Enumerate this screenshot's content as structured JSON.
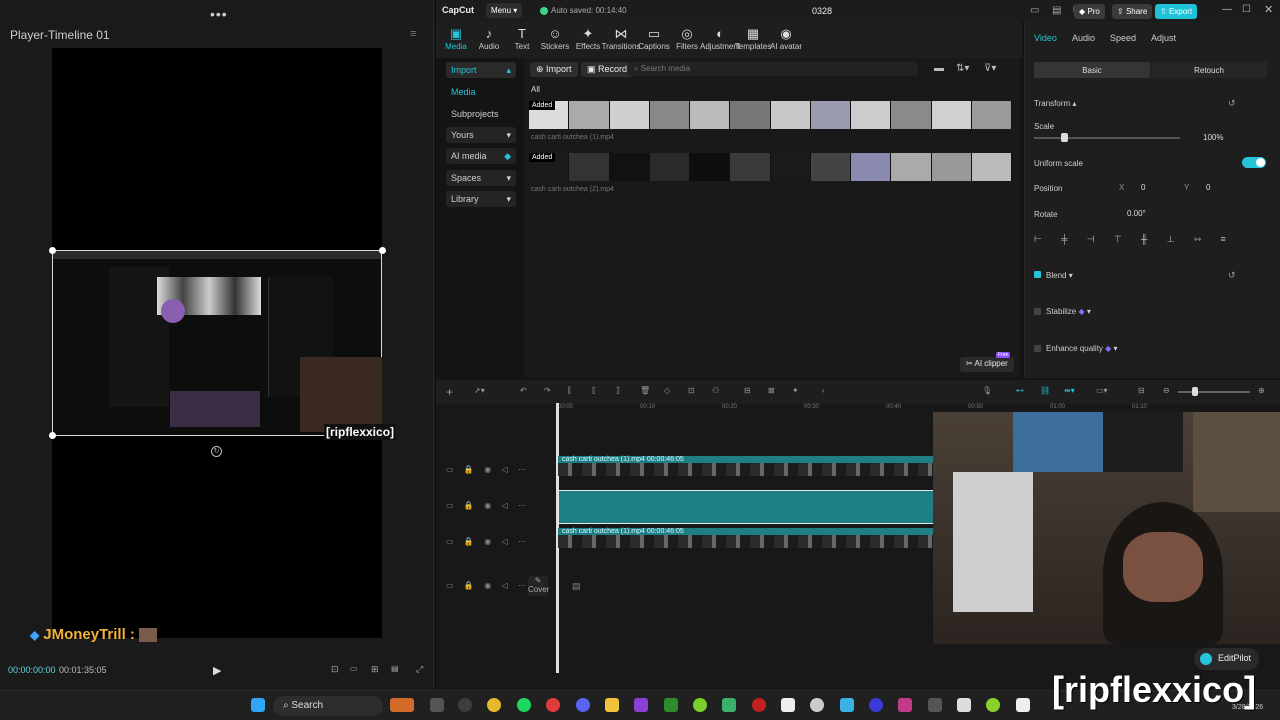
{
  "player": {
    "title": "Player-Timeline 01",
    "current_time": "00:00:00:00",
    "total_time": "00:01:35:05",
    "watermark": "[ripflexxico]",
    "chat_user": "JMoneyTrill :"
  },
  "topbar": {
    "app_name": "CapCut",
    "menu_label": "Menu",
    "autosave": "Auto saved: 00:14:40",
    "project_name": "0328",
    "pro_label": "Pro",
    "share_label": "Share",
    "export_label": "Export"
  },
  "toolbar": {
    "tools": [
      "Media",
      "Audio",
      "Text",
      "Stickers",
      "Effects",
      "Transitions",
      "Captions",
      "Filters",
      "Adjustment",
      "Templates",
      "AI avatar"
    ]
  },
  "media_nav": {
    "items": [
      "Import",
      "Media",
      "Subprojects",
      "Yours",
      "AI media",
      "Spaces",
      "Library"
    ]
  },
  "media": {
    "import_label": "Import",
    "record_label": "Record",
    "search_placeholder": "Search media",
    "filter_label": "All",
    "clips": [
      {
        "badge": "Added",
        "name": "cash carti outchea (1).mp4"
      },
      {
        "badge": "Added",
        "name": "cash carti outchea (2).mp4"
      }
    ],
    "ai_clipper": "AI clipper",
    "ai_badge": "Free"
  },
  "inspector": {
    "tabs": [
      "Video",
      "Audio",
      "Speed",
      "Adjust"
    ],
    "subtabs": [
      "Basic",
      "Retouch"
    ],
    "transform": "Transform",
    "scale_label": "Scale",
    "scale_value": "100%",
    "uniform_scale": "Uniform scale",
    "position_label": "Position",
    "pos_x_label": "X",
    "pos_x": "0",
    "pos_y_label": "Y",
    "pos_y": "0",
    "rotate_label": "Rotate",
    "rotate_value": "0.00°",
    "blend": "Blend",
    "stabilize": "Stabilize",
    "enhance_quality": "Enhance quality"
  },
  "timeline": {
    "ruler": [
      "00:00",
      "00:10",
      "00:20",
      "00:30",
      "00:40",
      "00:50",
      "01:00",
      "01:10"
    ],
    "track1": "cash carti outchea (1).mp4  00:00:46:05",
    "track2": "cash carti outchea (1).mp4  00:00:46:05",
    "cover_label": "Cover"
  },
  "taskbar": {
    "search_label": "Search",
    "date": "3/28/2026"
  },
  "overlay": {
    "editpilot": "EditPilot",
    "watermark_big": "[ripflexxico]"
  },
  "colors": {
    "accent": "#25c4d8",
    "track": "#1f7f86",
    "export": "#1fc2d6"
  }
}
